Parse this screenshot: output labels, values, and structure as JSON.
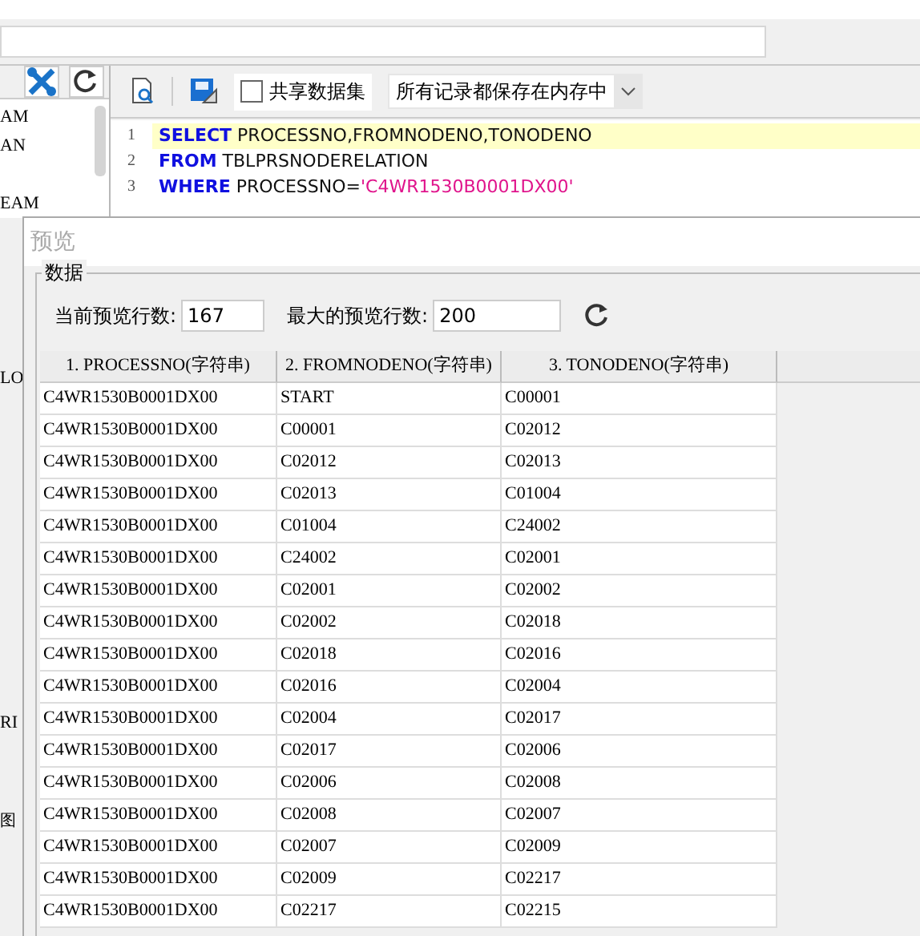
{
  "left_toolbar": {
    "buttons": [
      {
        "kind": "tools"
      },
      {
        "kind": "refresh"
      }
    ]
  },
  "left_tree": {
    "items": [
      "AM",
      "AN",
      "EAM"
    ],
    "lower_items": [
      "LO",
      "RI",
      "图"
    ]
  },
  "editor_toolbar": {
    "share_checkbox": {
      "label": "共享数据集",
      "checked": false
    },
    "storage_dropdown": {
      "value": "所有记录都保存在内存中"
    }
  },
  "editor": {
    "lines": [
      {
        "number": "1",
        "current": true,
        "tokens": [
          {
            "kind": "keyword",
            "text": "SELECT"
          },
          {
            "kind": "plain",
            "text": " PROCESSNO,FROMNODENO,TONODENO"
          }
        ]
      },
      {
        "number": "2",
        "current": false,
        "tokens": [
          {
            "kind": "keyword",
            "text": "FROM"
          },
          {
            "kind": "plain",
            "text": " TBLPRSNODERELATION"
          }
        ]
      },
      {
        "number": "3",
        "current": false,
        "tokens": [
          {
            "kind": "keyword",
            "text": "WHERE"
          },
          {
            "kind": "plain",
            "text": " PROCESSNO="
          },
          {
            "kind": "string",
            "text": "'C4WR1530B0001DX00'"
          }
        ]
      }
    ]
  },
  "preview_dialog": {
    "title": "预览",
    "group_title": "数据",
    "current_rows": {
      "label": "当前预览行数:",
      "value": "167"
    },
    "max_rows": {
      "label": "最大的预览行数:",
      "value": "200"
    },
    "table": {
      "columns": [
        "1. PROCESSNO(字符串)",
        "2. FROMNODENO(字符串)",
        "3. TONODENO(字符串)"
      ],
      "rows": [
        [
          "C4WR1530B0001DX00",
          "START",
          "C00001"
        ],
        [
          "C4WR1530B0001DX00",
          "C00001",
          "C02012"
        ],
        [
          "C4WR1530B0001DX00",
          "C02012",
          "C02013"
        ],
        [
          "C4WR1530B0001DX00",
          "C02013",
          "C01004"
        ],
        [
          "C4WR1530B0001DX00",
          "C01004",
          "C24002"
        ],
        [
          "C4WR1530B0001DX00",
          "C24002",
          "C02001"
        ],
        [
          "C4WR1530B0001DX00",
          "C02001",
          "C02002"
        ],
        [
          "C4WR1530B0001DX00",
          "C02002",
          "C02018"
        ],
        [
          "C4WR1530B0001DX00",
          "C02018",
          "C02016"
        ],
        [
          "C4WR1530B0001DX00",
          "C02016",
          "C02004"
        ],
        [
          "C4WR1530B0001DX00",
          "C02004",
          "C02017"
        ],
        [
          "C4WR1530B0001DX00",
          "C02017",
          "C02006"
        ],
        [
          "C4WR1530B0001DX00",
          "C02006",
          "C02008"
        ],
        [
          "C4WR1530B0001DX00",
          "C02008",
          "C02007"
        ],
        [
          "C4WR1530B0001DX00",
          "C02007",
          "C02009"
        ],
        [
          "C4WR1530B0001DX00",
          "C02009",
          "C02217"
        ],
        [
          "C4WR1530B0001DX00",
          "C02217",
          "C02215"
        ]
      ]
    }
  }
}
